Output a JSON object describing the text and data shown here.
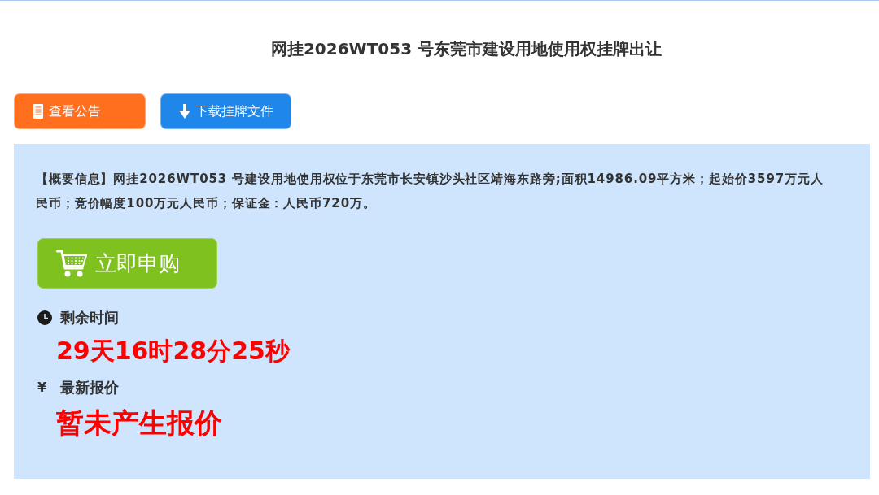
{
  "title": "网挂2026WT053 号东莞市建设用地使用权挂牌出让",
  "actions": [
    {
      "kind": "notice",
      "label": "查看公告"
    },
    {
      "kind": "download",
      "label": "下载挂牌文件"
    }
  ],
  "summary": "【概要信息】网挂2026WT053 号建设用地使用权位于东莞市长安镇沙头社区靖海东路旁;面积14986.09平方米；起始价3597万元人民币；竞价幅度100万元人民币；保证金：人民币720万。",
  "buy_button": {
    "label": "立即申购"
  },
  "remaining_time": {
    "label": "剩余时间",
    "value": "29天16时28分25秒"
  },
  "latest_bid": {
    "symbol": "¥",
    "label": "最新报价",
    "value": "暂未产生报价"
  }
}
